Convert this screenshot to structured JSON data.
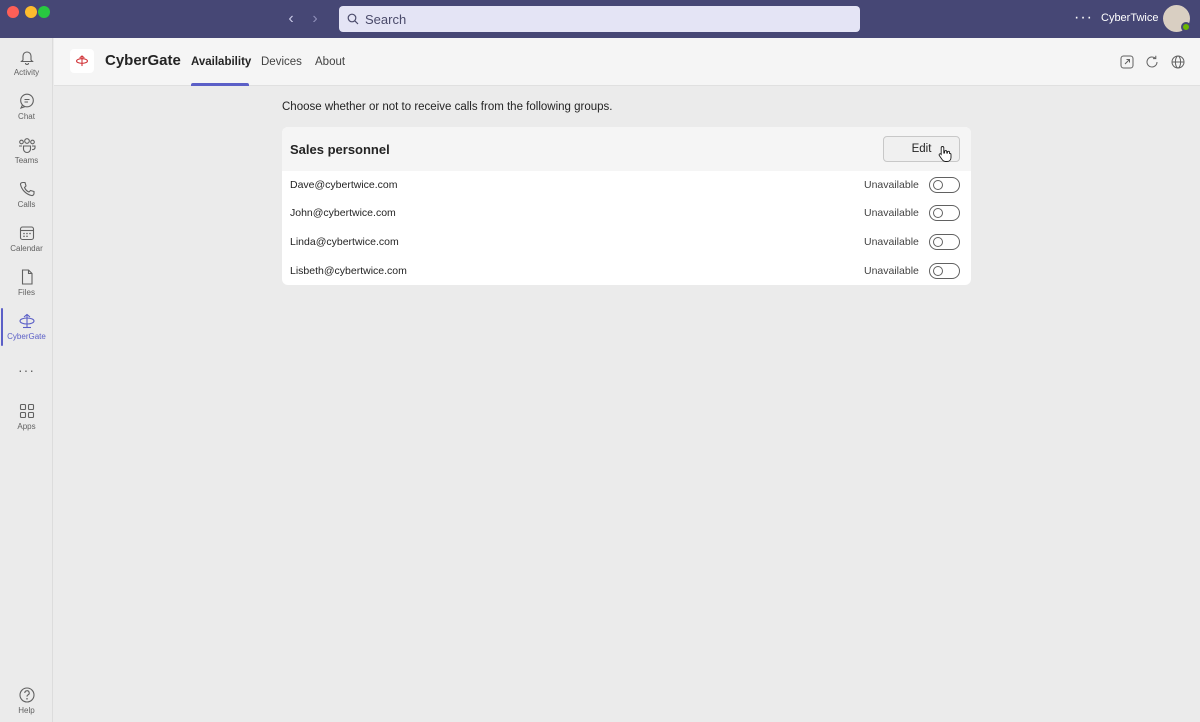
{
  "titlebar": {
    "search_placeholder": "Search",
    "user_name": "CyberTwice",
    "more_label": "···"
  },
  "rail": {
    "items": [
      {
        "label": "Activity",
        "icon": "bell-icon"
      },
      {
        "label": "Chat",
        "icon": "chat-icon"
      },
      {
        "label": "Teams",
        "icon": "teams-icon"
      },
      {
        "label": "Calls",
        "icon": "phone-icon"
      },
      {
        "label": "Calendar",
        "icon": "calendar-icon"
      },
      {
        "label": "Files",
        "icon": "file-icon"
      },
      {
        "label": "CyberGate",
        "icon": "cybergate-icon",
        "active": true
      },
      {
        "label": "Apps",
        "icon": "apps-icon"
      },
      {
        "label": "Help",
        "icon": "help-icon"
      }
    ],
    "more_label": "···"
  },
  "app": {
    "name": "CyberGate",
    "tabs": [
      {
        "label": "Availability",
        "active": true
      },
      {
        "label": "Devices"
      },
      {
        "label": "About"
      }
    ]
  },
  "main": {
    "intro": "Choose whether or not to receive calls from the following groups.",
    "group": {
      "title": "Sales personnel",
      "edit_label": "Edit",
      "members": [
        {
          "email": "Dave@cybertwice.com",
          "status": "Unavailable",
          "on": false
        },
        {
          "email": "John@cybertwice.com",
          "status": "Unavailable",
          "on": false
        },
        {
          "email": "Linda@cybertwice.com",
          "status": "Unavailable",
          "on": false
        },
        {
          "email": "Lisbeth@cybertwice.com",
          "status": "Unavailable",
          "on": false
        }
      ]
    }
  },
  "colors": {
    "titlebar": "#464775",
    "accent": "#5b5fc7",
    "brand_red": "#d13438"
  }
}
